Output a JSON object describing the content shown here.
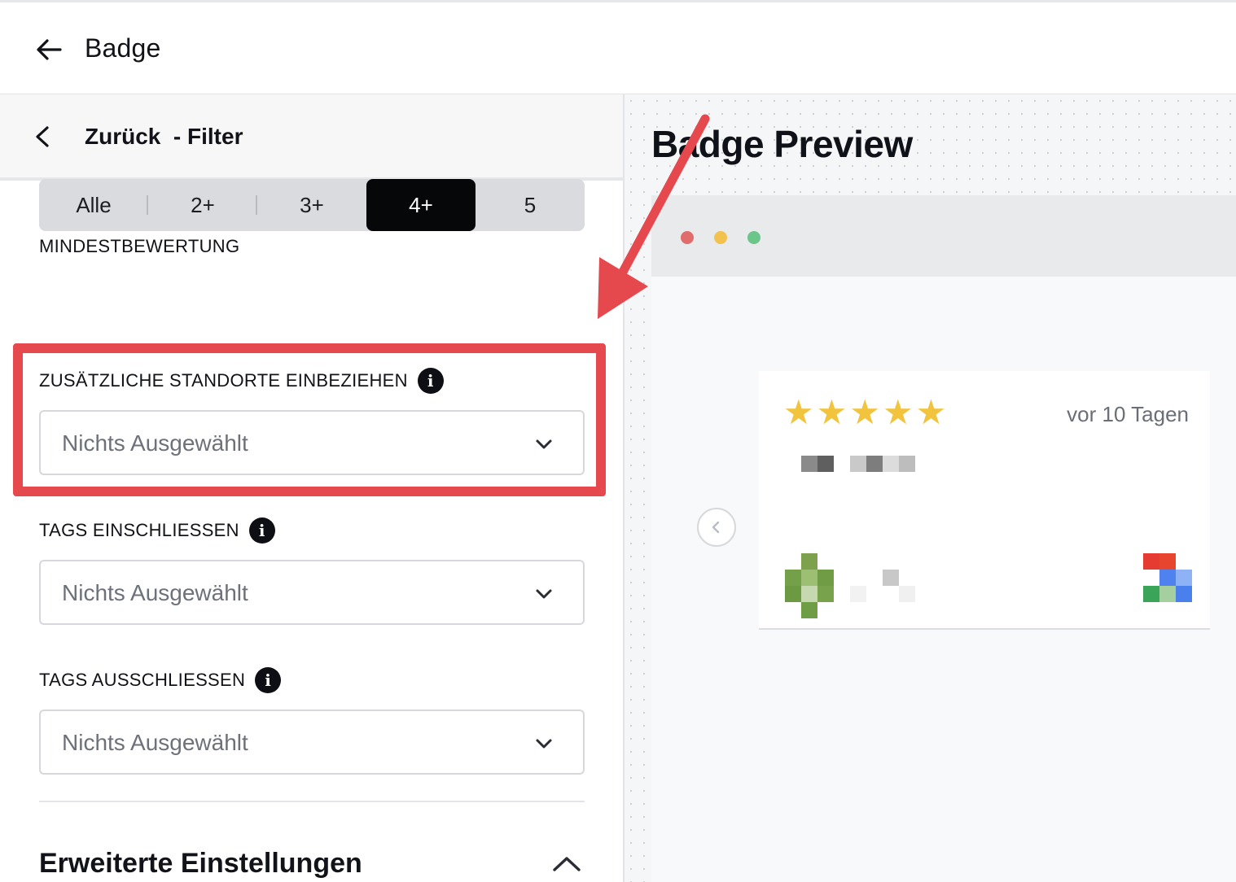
{
  "header": {
    "title": "Badge",
    "back_icon": "arrow-left-icon"
  },
  "subheader": {
    "label": "Zurück  - Filter",
    "back_icon": "chevron-left-icon"
  },
  "rating": {
    "label": "MINDESTBEWERTUNG",
    "options": [
      "Alle",
      "2+",
      "3+",
      "4+",
      "5"
    ],
    "selected": "4+"
  },
  "locations": {
    "label": "ZUSÄTZLICHE STANDORTE EINBEZIEHEN",
    "value": "Nichts Ausgewählt",
    "info_icon": "i"
  },
  "tags_include": {
    "label": "TAGS EINSCHLIESSEN",
    "value": "Nichts Ausgewählt",
    "info_icon": "i"
  },
  "tags_exclude": {
    "label": "TAGS AUSSCHLIESSEN",
    "value": "Nichts Ausgewählt",
    "info_icon": "i"
  },
  "advanced": {
    "title": "Erweiterte Einstellungen"
  },
  "preview": {
    "title": "Badge Preview",
    "window_dots": [
      "#e06c6c",
      "#f2c14e",
      "#6cc68a"
    ],
    "review": {
      "stars": 5,
      "star_glyph": "★",
      "date": "vor 10 Tagen"
    }
  },
  "colors": {
    "highlight": "#e5484d",
    "active_segment": "#060709",
    "star": "#f2c33c"
  }
}
